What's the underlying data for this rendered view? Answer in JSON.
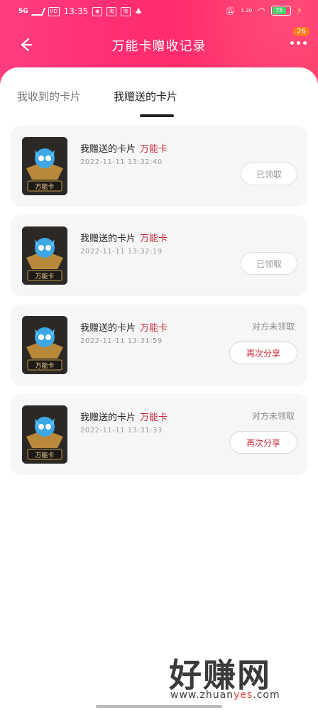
{
  "status_bar": {
    "network": "5G",
    "hd": "HD",
    "time": "13:35",
    "speed": "1.20",
    "battery": "75"
  },
  "header": {
    "title": "万能卡赠收记录",
    "badge": "26"
  },
  "tabs": [
    {
      "label": "我收到的卡片",
      "active": false
    },
    {
      "label": "我赠送的卡片",
      "active": true
    }
  ],
  "cards": [
    {
      "title": "我赠送的卡片",
      "kind": "万能卡",
      "time": "2022-11-11 13:32:40",
      "status": "",
      "action": "已领取",
      "thumb_label": "万能卡"
    },
    {
      "title": "我赠送的卡片",
      "kind": "万能卡",
      "time": "2022-11-11 13:32:19",
      "status": "",
      "action": "已领取",
      "thumb_label": "万能卡"
    },
    {
      "title": "我赠送的卡片",
      "kind": "万能卡",
      "time": "2022-11-11 13:31:59",
      "status": "对方未领取",
      "action": "再次分享",
      "thumb_label": "万能卡"
    },
    {
      "title": "我赠送的卡片",
      "kind": "万能卡",
      "time": "2022-11-11 13:31:33",
      "status": "对方未领取",
      "action": "再次分享",
      "thumb_label": "万能卡"
    }
  ],
  "watermark": {
    "big": "好赚网",
    "small_prefix": "www.zhuan",
    "small_highlight": "yes",
    "small_suffix": ".com"
  },
  "colors": {
    "header_pink": "#ff2f73",
    "accent_red": "#c7283a"
  }
}
